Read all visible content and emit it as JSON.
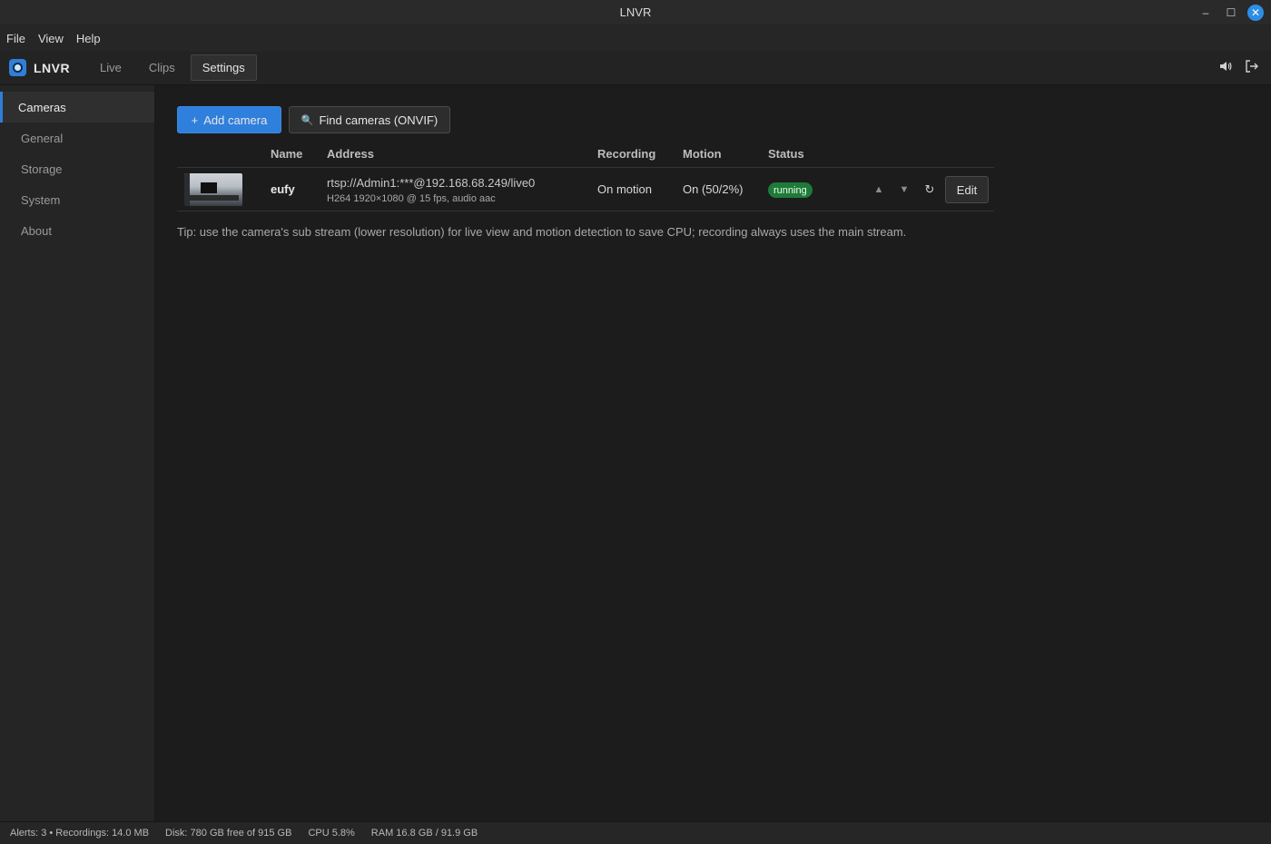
{
  "window": {
    "title": "LNVR",
    "controls": {
      "minimize": "–",
      "maximize": "☐",
      "close": "✕"
    }
  },
  "menu": [
    "File",
    "View",
    "Help"
  ],
  "app": {
    "brand": "LNVR",
    "tabs": [
      {
        "label": "Live",
        "active": false
      },
      {
        "label": "Clips",
        "active": false
      },
      {
        "label": "Settings",
        "active": true
      }
    ],
    "right_icons": [
      "speaker-icon",
      "logout-icon"
    ]
  },
  "sidebar": {
    "items": [
      {
        "label": "Cameras",
        "active": true
      },
      {
        "label": "General",
        "active": false
      },
      {
        "label": "Storage",
        "active": false
      },
      {
        "label": "System",
        "active": false
      },
      {
        "label": "About",
        "active": false
      }
    ]
  },
  "toolbar": {
    "add_label": "Add camera",
    "add_icon": "+",
    "find_label": "Find cameras (ONVIF)",
    "find_icon": "🔍"
  },
  "table": {
    "headers": {
      "name": "Name",
      "address": "Address",
      "recording": "Recording",
      "motion": "Motion",
      "status": "Status"
    },
    "rows": [
      {
        "name": "eufy",
        "address": "rtsp://Admin1:***@192.168.68.249/live0",
        "stream_info": "H264 1920×1080 @ 15 fps, audio aac",
        "recording": "On motion",
        "motion": "On (50/2%)",
        "status": "running",
        "actions": {
          "up": "▲",
          "down": "▼",
          "refresh": "↻",
          "edit": "Edit"
        }
      }
    ]
  },
  "tip": "Tip: use the camera's sub stream (lower resolution) for live view and motion detection to save CPU; recording always uses the main stream.",
  "statusbar": {
    "alerts": "Alerts: 3 • Recordings: 14.0 MB",
    "disk": "Disk: 780 GB free of 915 GB",
    "cpu": "CPU 5.8%",
    "ram": "RAM 16.8 GB / 91.9 GB"
  },
  "colors": {
    "accent": "#2f80dc",
    "status_running": "#1f7a3a"
  }
}
